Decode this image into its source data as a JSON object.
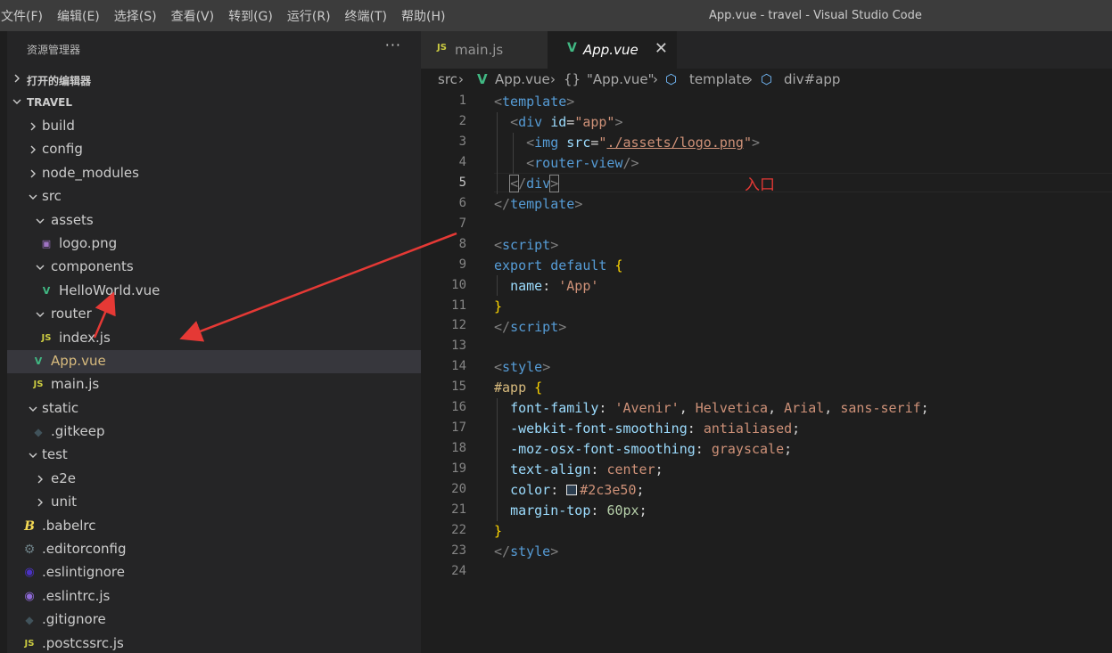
{
  "menu": [
    "文件(F)",
    "编辑(E)",
    "选择(S)",
    "查看(V)",
    "转到(G)",
    "运行(R)",
    "终端(T)",
    "帮助(H)"
  ],
  "window_title": "App.vue - travel - Visual Studio Code",
  "sidebar": {
    "title": "资源管理器",
    "more": "···",
    "open_editors": "打开的编辑器",
    "project": "TRAVEL",
    "items": [
      {
        "label": "build",
        "type": "folder",
        "expanded": false,
        "depth": 1
      },
      {
        "label": "config",
        "type": "folder",
        "expanded": false,
        "depth": 1
      },
      {
        "label": "node_modules",
        "type": "folder",
        "expanded": false,
        "depth": 1
      },
      {
        "label": "src",
        "type": "folder",
        "expanded": true,
        "depth": 1
      },
      {
        "label": "assets",
        "type": "folder",
        "expanded": true,
        "depth": 2
      },
      {
        "label": "logo.png",
        "type": "image",
        "depth": 3
      },
      {
        "label": "components",
        "type": "folder",
        "expanded": true,
        "depth": 2
      },
      {
        "label": "HelloWorld.vue",
        "type": "vue",
        "depth": 3
      },
      {
        "label": "router",
        "type": "folder",
        "expanded": true,
        "depth": 2
      },
      {
        "label": "index.js",
        "type": "js",
        "depth": 3
      },
      {
        "label": "App.vue",
        "type": "vue",
        "depth": 2,
        "selected": true
      },
      {
        "label": "main.js",
        "type": "js",
        "depth": 2
      },
      {
        "label": "static",
        "type": "folder",
        "expanded": true,
        "depth": 1
      },
      {
        "label": ".gitkeep",
        "type": "git",
        "depth": 2
      },
      {
        "label": "test",
        "type": "folder",
        "expanded": true,
        "depth": 1
      },
      {
        "label": "e2e",
        "type": "folder",
        "expanded": false,
        "depth": 2
      },
      {
        "label": "unit",
        "type": "folder",
        "expanded": false,
        "depth": 2
      },
      {
        "label": ".babelrc",
        "type": "babel",
        "depth": 1
      },
      {
        "label": ".editorconfig",
        "type": "gear",
        "depth": 1
      },
      {
        "label": ".eslintignore",
        "type": "eslint",
        "depth": 1
      },
      {
        "label": ".eslintrc.js",
        "type": "eslintrc",
        "depth": 1
      },
      {
        "label": ".gitignore",
        "type": "git",
        "depth": 1
      },
      {
        "label": ".postcssrc.js",
        "type": "js",
        "depth": 1
      }
    ]
  },
  "icons": {
    "js": "JS",
    "vue": "V",
    "image": "▣",
    "babel": "B",
    "gear": "⚙",
    "eslint": "◉",
    "eslintrc": "◉",
    "git": "◆"
  },
  "tabs": [
    {
      "label": "main.js",
      "icon": "JS",
      "active": false
    },
    {
      "label": "App.vue",
      "icon": "V",
      "active": true,
      "close": "✕"
    }
  ],
  "breadcrumb": {
    "src": "src",
    "file": "App.vue",
    "obj_icon": "{}",
    "obj": "\"App.vue\"",
    "tmpl": "template",
    "div": "div#app"
  },
  "editor": {
    "line_numbers": [
      "1",
      "2",
      "3",
      "4",
      "5",
      "6",
      "7",
      "8",
      "9",
      "10",
      "11",
      "12",
      "13",
      "14",
      "15",
      "16",
      "17",
      "18",
      "19",
      "20",
      "21",
      "22",
      "23",
      "24"
    ],
    "annotation": "入口",
    "swatch_color": "#2c3e50"
  },
  "colors": {
    "accent_vue": "#41b883",
    "js": "#cbcb41",
    "annotation": "#e53935"
  }
}
